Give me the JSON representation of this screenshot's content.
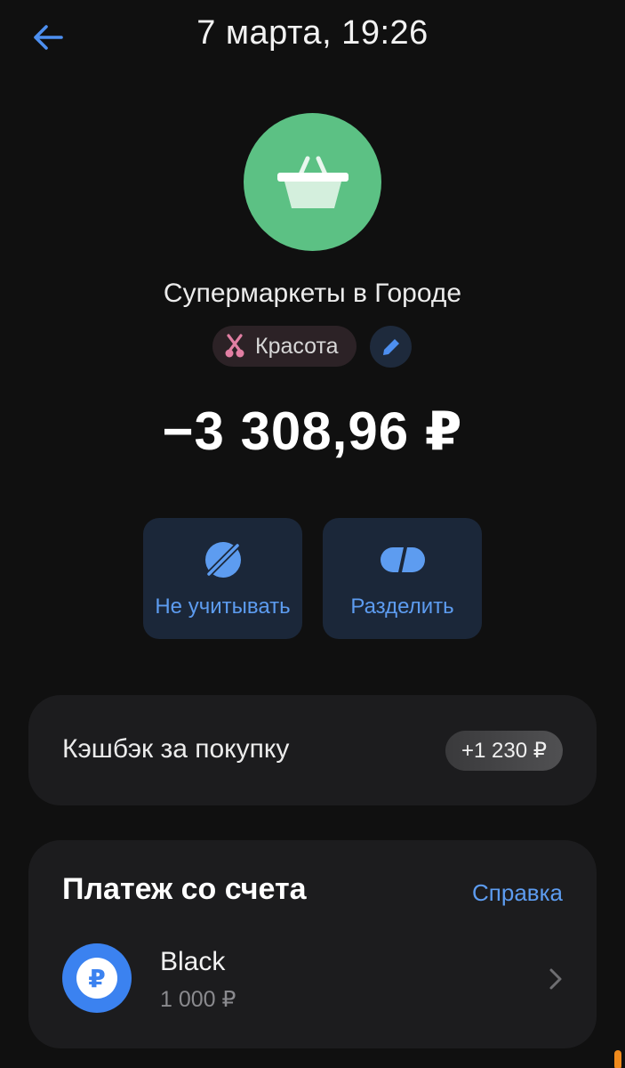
{
  "header": {
    "title": "7 марта, 19:26",
    "back_icon": "arrow-left-icon"
  },
  "merchant": {
    "name": "Супермаркеты в Городе",
    "icon": "basket-icon",
    "avatar_color": "#5cc184"
  },
  "category": {
    "label": "Красота",
    "icon": "scissors-icon",
    "edit_icon": "pencil-icon"
  },
  "amount": "−3 308,96 ₽",
  "actions": [
    {
      "label": "Не учитывать",
      "icon": "eye-off-icon"
    },
    {
      "label": "Разделить",
      "icon": "split-icon"
    }
  ],
  "cashback": {
    "label": "Кэшбэк за покупку",
    "value": "+1 230 ₽"
  },
  "payment": {
    "title": "Платеж со счета",
    "help_label": "Справка",
    "account": {
      "name": "Black",
      "balance": "1 000 ₽",
      "icon": "ruble-icon",
      "icon_glyph": "₽"
    }
  },
  "colors": {
    "accent": "#5d9cf0",
    "background": "#101010",
    "card": "#1c1c1e",
    "merchant_green": "#5cc184"
  }
}
